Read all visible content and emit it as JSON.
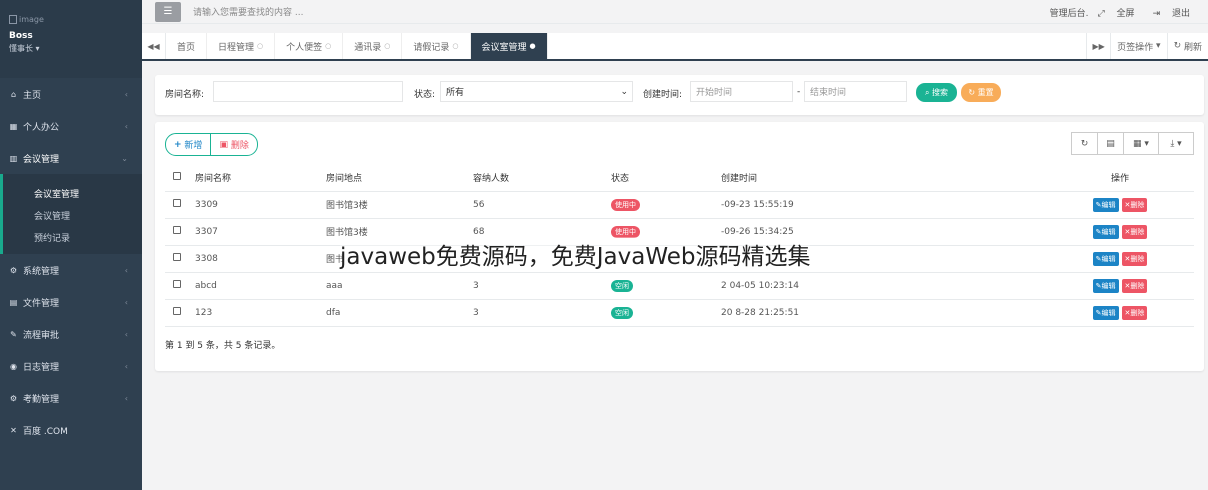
{
  "sidebar": {
    "profile": {
      "image_alt": "image",
      "name": "Boss",
      "role": "懂事长"
    },
    "items": [
      {
        "icon": "home-icon",
        "glyph": "⌂",
        "label": "主页"
      },
      {
        "icon": "calendar-icon",
        "glyph": "▦",
        "label": "个人办公"
      },
      {
        "icon": "building-icon",
        "glyph": "▥",
        "label": "会议管理",
        "expanded": true
      },
      {
        "icon": "gear-icon",
        "glyph": "⚙",
        "label": "系统管理"
      },
      {
        "icon": "file-icon",
        "glyph": "▤",
        "label": "文件管理"
      },
      {
        "icon": "wrench-icon",
        "glyph": "✎",
        "label": "流程审批"
      },
      {
        "icon": "eye-icon",
        "glyph": "◉",
        "label": "日志管理"
      },
      {
        "icon": "gears-icon",
        "glyph": "⚙",
        "label": "考勤管理"
      },
      {
        "icon": "x-icon",
        "glyph": "✕",
        "label": "百度 .COM"
      }
    ],
    "submenu": [
      "会议室管理",
      "会议管理",
      "预约记录"
    ]
  },
  "topbar": {
    "search_placeholder": "请输入您需要查找的内容 ...",
    "admin_link": "管理后台.",
    "fullscreen": "全屏",
    "logout": "退出"
  },
  "tabs": {
    "items": [
      "首页",
      "日程管理",
      "个人便签",
      "通讯录",
      "请假记录",
      "会议室管理"
    ],
    "active": "会议室管理",
    "tab_ops": "页签操作",
    "refresh": "刷新"
  },
  "search": {
    "name_label": "房间名称:",
    "status_label": "状态:",
    "status_value": "所有",
    "time_label": "创建时间:",
    "start_placeholder": "开始时间",
    "end_placeholder": "结束时间",
    "search_btn": "搜索",
    "reset_btn": "重置"
  },
  "toolbar": {
    "add": "新增",
    "delete": "删除"
  },
  "table": {
    "headers": [
      "房间名称",
      "房间地点",
      "容纳人数",
      "状态",
      "创建时间",
      "操作"
    ],
    "rows": [
      {
        "name": "3309",
        "location": "图书馆3楼",
        "capacity": "56",
        "status": "使用中",
        "status_type": "busy",
        "created": "-09-23 15:55:19"
      },
      {
        "name": "3307",
        "location": "图书馆3楼",
        "capacity": "68",
        "status": "使用中",
        "status_type": "busy",
        "created": "-09-26 15:34:25"
      },
      {
        "name": "3308",
        "location": "图书",
        "capacity": "",
        "status": "",
        "status_type": "none",
        "created": ""
      },
      {
        "name": "abcd",
        "location": "aaa",
        "capacity": "3",
        "status": "空闲",
        "status_type": "free",
        "created": "2 04-05 10:23:14"
      },
      {
        "name": "123",
        "location": "dfa",
        "capacity": "3",
        "status": "空闲",
        "status_type": "free",
        "created": "20 8-28 21:25:51"
      }
    ],
    "edit_label": "编辑",
    "delete_label": "删除",
    "pager_text": "第 1 到 5 条，共 5 条记录。"
  },
  "watermark": "javaweb免费源码，免费JavaWeb源码精选集"
}
